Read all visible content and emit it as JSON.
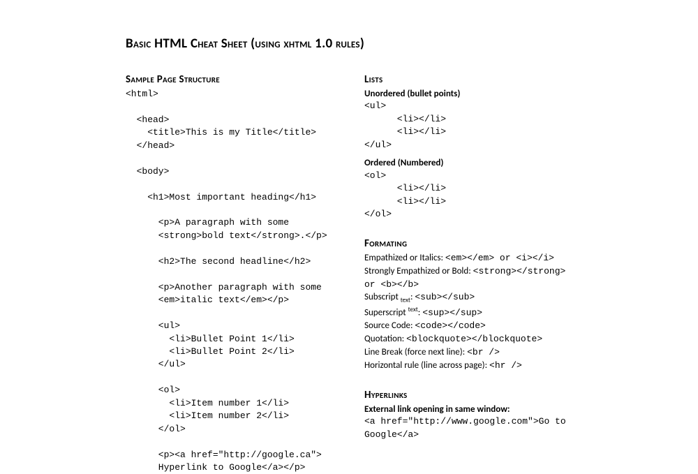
{
  "title": "Basic HTML Cheat Sheet (using xhtml 1.0 rules)",
  "left": {
    "heading": "Sample Page Structure",
    "code": "<html>\n\n  <head>\n    <title>This is my Title</title>\n  </head>\n\n  <body>\n\n    <h1>Most important heading</h1>\n\n      <p>A paragraph with some\n      <strong>bold text</strong>.</p>\n\n      <h2>The second headline</h2>\n\n      <p>Another paragraph with some\n      <em>italic text</em></p>\n\n      <ul>\n        <li>Bullet Point 1</li>\n        <li>Bullet Point 2</li>\n      </ul>\n\n      <ol>\n        <li>Item number 1</li>\n        <li>Item number 2</li>\n      </ol>\n\n      <p><a href=\"http://google.ca\">\n      Hyperlink to Google</a></p>"
  },
  "lists": {
    "heading": "Lists",
    "unordered_label": "Unordered (bullet points)",
    "unordered_code": "<ul>\n      <li></li>\n      <li></li>\n</ul>",
    "ordered_label": "Ordered (Numbered)",
    "ordered_code": "<ol>\n      <li></li>\n      <li></li>\n</ol>"
  },
  "formatting": {
    "heading": "Formating",
    "rows": [
      {
        "label": "Empathized or Italics: ",
        "code": "<em></em> or <i></i>"
      },
      {
        "label": "Strongly Empathized or Bold: ",
        "code": "<strong></strong> or <b></b>"
      },
      {
        "label_pre": "Subscript ",
        "label_sub": "text",
        "label_post": ": ",
        "code": "<sub></sub>"
      },
      {
        "label_pre": "Superscript ",
        "label_sup": "text",
        "label_post": ": ",
        "code": "<sup></sup>"
      },
      {
        "label": "Source Code: ",
        "code": "<code></code>"
      },
      {
        "label": "Quotation: ",
        "code": "<blockquote></blockquote>"
      },
      {
        "label": "Line Break (force next line): ",
        "code": "<br />"
      },
      {
        "label": "Horizontal rule (line across page): ",
        "code": "<hr />"
      }
    ]
  },
  "hyperlinks": {
    "heading": "Hyperlinks",
    "sub_label": "External link opening in same window:",
    "code": "<a href=\"http://www.google.com\">Go to\nGoogle</a>"
  }
}
